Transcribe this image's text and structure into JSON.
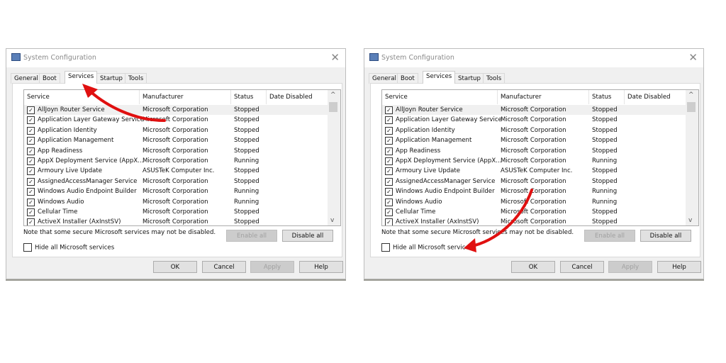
{
  "dialog": {
    "title": "System Configuration",
    "tabs": [
      "General",
      "Boot",
      "Services",
      "Startup",
      "Tools"
    ],
    "active_tab": "Services",
    "columns": [
      "Service",
      "Manufacturer",
      "Status",
      "Date Disabled"
    ],
    "rows": [
      {
        "service": "AllJoyn Router Service",
        "manufacturer": "Microsoft Corporation",
        "status": "Stopped",
        "checked": true
      },
      {
        "service": "Application Layer Gateway Service",
        "manufacturer": "Microsoft Corporation",
        "status": "Stopped",
        "checked": true
      },
      {
        "service": "Application Identity",
        "manufacturer": "Microsoft Corporation",
        "status": "Stopped",
        "checked": true
      },
      {
        "service": "Application Management",
        "manufacturer": "Microsoft Corporation",
        "status": "Stopped",
        "checked": true
      },
      {
        "service": "App Readiness",
        "manufacturer": "Microsoft Corporation",
        "status": "Stopped",
        "checked": true
      },
      {
        "service": "AppX Deployment Service (AppX...",
        "manufacturer": "Microsoft Corporation",
        "status": "Running",
        "checked": true
      },
      {
        "service": "Armoury Live Update",
        "manufacturer": "ASUSTeK Computer Inc.",
        "status": "Stopped",
        "checked": true
      },
      {
        "service": "AssignedAccessManager Service",
        "manufacturer": "Microsoft Corporation",
        "status": "Stopped",
        "checked": true
      },
      {
        "service": "Windows Audio Endpoint Builder",
        "manufacturer": "Microsoft Corporation",
        "status": "Running",
        "checked": true
      },
      {
        "service": "Windows Audio",
        "manufacturer": "Microsoft Corporation",
        "status": "Running",
        "checked": true
      },
      {
        "service": "Cellular Time",
        "manufacturer": "Microsoft Corporation",
        "status": "Stopped",
        "checked": true
      },
      {
        "service": "ActiveX Installer (AxInstSV)",
        "manufacturer": "Microsoft Corporation",
        "status": "Stopped",
        "checked": true
      }
    ],
    "note": "Note that some secure Microsoft services may not be disabled.",
    "enable_all": "Enable all",
    "disable_all": "Disable all",
    "hide_ms": "Hide all Microsoft services",
    "hide_ms_checked": false,
    "ok": "OK",
    "cancel": "Cancel",
    "apply": "Apply",
    "help": "Help"
  },
  "annotation_color": "#e01010"
}
